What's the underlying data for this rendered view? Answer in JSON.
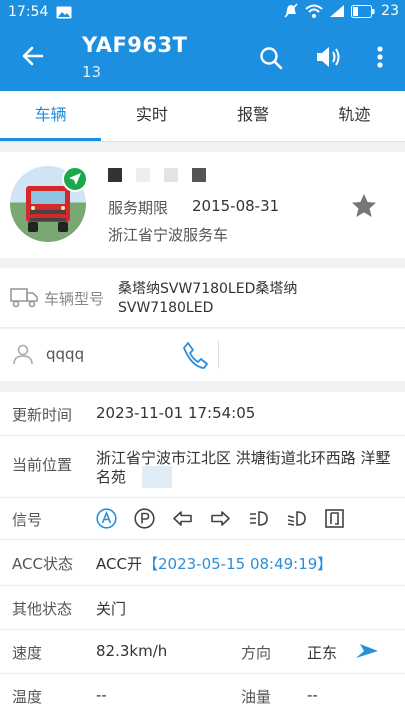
{
  "status_bar": {
    "time": "17:54",
    "battery": "23"
  },
  "app_bar": {
    "title": "YAF963T",
    "subtitle": "13"
  },
  "tabs": [
    {
      "label": "车辆",
      "active": true
    },
    {
      "label": "实时",
      "active": false
    },
    {
      "label": "报警",
      "active": false
    },
    {
      "label": "轨迹",
      "active": false
    }
  ],
  "vehicle_card": {
    "service_label": "服务期限",
    "service_date": "2015-08-31",
    "org": "浙江省宁波服务车"
  },
  "model": {
    "label": "车辆型号",
    "value": "桑塔纳SVW7180LED桑塔纳SVW7180LED"
  },
  "driver": {
    "name": "qqqq"
  },
  "details": {
    "update_label": "更新时间",
    "update_value": "2023-11-01 17:54:05",
    "location_label": "当前位置",
    "location_value": "浙江省宁波市江北区 洪塘街道北环西路 洋墅名苑",
    "signal_label": "信号",
    "acc_label": "ACC状态",
    "acc_value": "ACC开",
    "acc_time": "【2023-05-15 08:49:19】",
    "other_label": "其他状态",
    "other_value": "关门",
    "speed_label": "速度",
    "speed_value": "82.3km/h",
    "direction_label": "方向",
    "direction_value": "正东",
    "temp_label": "温度",
    "temp_value": "--",
    "oil_label": "油量",
    "oil_value": "--"
  },
  "colors": {
    "accent": "#1d8fe0",
    "link": "#2a8fd8",
    "speed": "#e53935"
  }
}
